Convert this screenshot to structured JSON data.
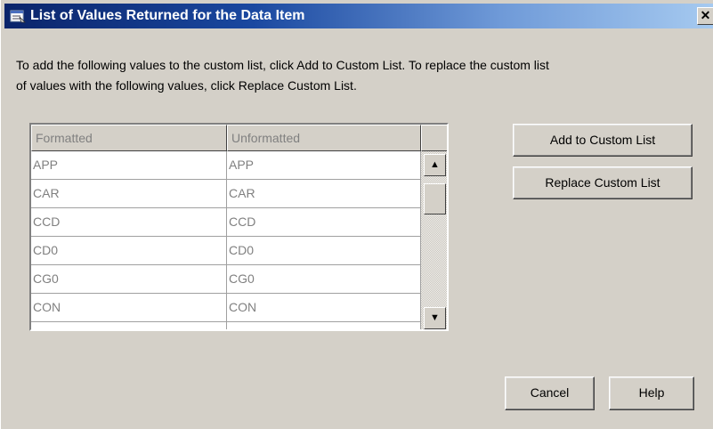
{
  "window": {
    "title": "List of Values Returned for the Data Item",
    "close_glyph": "✕"
  },
  "instructions": {
    "line1": "To add the following values to the custom list, click Add to Custom List.  To replace the custom list",
    "line2": "of values with the following values, click Replace Custom List."
  },
  "table": {
    "columns": [
      "Formatted",
      "Unformatted"
    ],
    "rows": [
      [
        "APP",
        "APP"
      ],
      [
        "CAR",
        "CAR"
      ],
      [
        "CCD",
        "CCD"
      ],
      [
        "CD0",
        "CD0"
      ],
      [
        "CG0",
        "CG0"
      ],
      [
        "CON",
        "CON"
      ]
    ],
    "scroll_up_glyph": "▲",
    "scroll_down_glyph": "▼"
  },
  "buttons": {
    "add": "Add to Custom List",
    "replace": "Replace Custom List",
    "cancel": "Cancel",
    "help": "Help"
  }
}
